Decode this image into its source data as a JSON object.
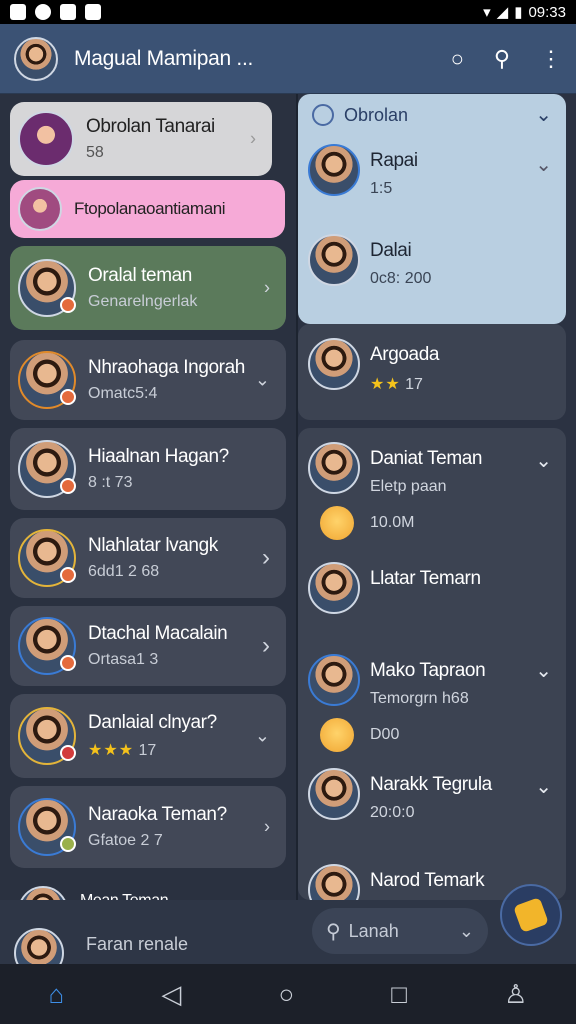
{
  "status_bar": {
    "time": "09:33"
  },
  "app_bar": {
    "title": "Magual Mamipan ..."
  },
  "left_list": {
    "items": [
      {
        "name": "Obrolan Tanarai",
        "sub": "58"
      },
      {
        "name": "Ftopolanaoantiamani",
        "sub": ""
      },
      {
        "name": "Oralal teman",
        "sub": "Genarelngerlak"
      },
      {
        "name": "Nhraohaga Ingorah",
        "sub": "Omatc5:4"
      },
      {
        "name": "Hiaalnan Hagan?",
        "sub": "8 :t 73"
      },
      {
        "name": "Nlahlatar lvangk",
        "sub": "6dd1 2 68"
      },
      {
        "name": "Dtachal Macalain",
        "sub": "Ortasa1 3"
      },
      {
        "name": "Danlaial clnyar?",
        "sub": "17"
      },
      {
        "name": "Naraoka Teman?",
        "sub": "Gfatoe 2 7"
      },
      {
        "name": "Mean Teman",
        "sub": ""
      }
    ],
    "footer_text": "Faran renale"
  },
  "right_list": {
    "header": "Obrolan",
    "items": [
      {
        "name": "Rapai",
        "sub": "1:5"
      },
      {
        "name": "Dalai",
        "sub": "0c8: 200"
      },
      {
        "name": "Argoada",
        "sub": "17"
      },
      {
        "name": "Daniat Teman",
        "sub": "Eletp paan",
        "extra": "10.0M"
      },
      {
        "name": "Llatar Temarn",
        "sub": ""
      },
      {
        "name": "Mako Tapraon",
        "sub": "Temorgrn h68",
        "extra": "D00"
      },
      {
        "name": "Narakk Tegrula",
        "sub": "20:0:0"
      },
      {
        "name": "Narod Temark",
        "sub": ""
      }
    ]
  },
  "search": {
    "placeholder": "Lanah"
  },
  "icons": [
    "search-icon",
    "menu-icon",
    "chevron-right-icon",
    "home-icon",
    "back-icon",
    "circle-home-icon",
    "recent-icon",
    "profile-icon"
  ],
  "colors": {
    "app_bar": "#3b5274",
    "pink_card": "#f6aad7",
    "green_card": "#5b7a5b",
    "light_blue_panel": "#b9cfe1"
  }
}
